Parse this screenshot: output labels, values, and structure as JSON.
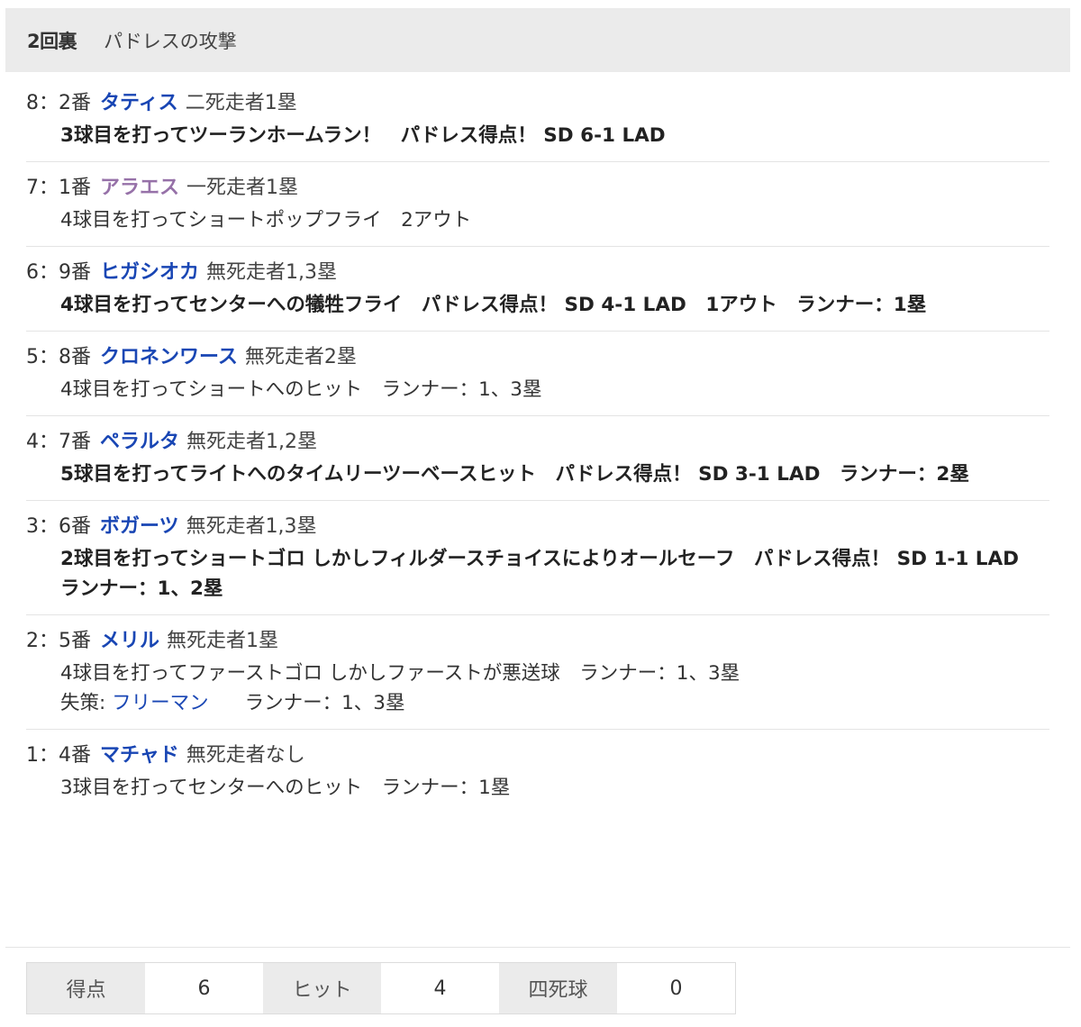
{
  "header": {
    "inning": "2回裏",
    "attack": "パドレスの攻撃"
  },
  "plays": [
    {
      "seq": "8：2番",
      "player": "タティス",
      "situation": "二死走者1塁",
      "result": "3球目を打ってツーランホームラン！　パドレス得点！ SD 6-1 LAD",
      "scored": true
    },
    {
      "seq": "7：1番",
      "player": "アラエス",
      "situation": "一死走者1塁",
      "result": "4球目を打ってショートポップフライ　2アウト",
      "scored": false
    },
    {
      "seq": "6：9番",
      "player": "ヒガシオカ",
      "situation": "無死走者1,3塁",
      "result": "4球目を打ってセンターへの犠牲フライ　パドレス得点！ SD 4-1 LAD　1アウト　ランナー：1塁",
      "scored": true
    },
    {
      "seq": "5：8番",
      "player": "クロネンワース",
      "situation": "無死走者2塁",
      "result": "4球目を打ってショートへのヒット　ランナー：1、3塁",
      "scored": false
    },
    {
      "seq": "4：7番",
      "player": "ペラルタ",
      "situation": "無死走者1,2塁",
      "result": "5球目を打ってライトへのタイムリーツーベースヒット　パドレス得点！ SD 3-1 LAD　ランナー：2塁",
      "scored": true
    },
    {
      "seq": "3：6番",
      "player": "ボガーツ",
      "situation": "無死走者1,3塁",
      "result": "2球目を打ってショートゴロ しかしフィルダースチョイスによりオールセーフ　パドレス得点！ SD 1-1 LAD　ランナー：1、2塁",
      "scored": true
    },
    {
      "seq": "2：5番",
      "player": "メリル",
      "situation": "無死走者1塁",
      "result": "4球目を打ってファーストゴロ しかしファーストが悪送球　ランナー：1、3塁",
      "scored": false,
      "error_label": "失策: ",
      "error_fielder": "フリーマン",
      "error_after": "ランナー：1、3塁"
    },
    {
      "seq": "1：4番",
      "player": "マチャド",
      "situation": "無死走者なし",
      "result": "3球目を打ってセンターへのヒット　ランナー：1塁",
      "scored": false
    }
  ],
  "stats": [
    {
      "label": "得点",
      "value": "6"
    },
    {
      "label": "ヒット",
      "value": "4"
    },
    {
      "label": "四死球",
      "value": "0"
    }
  ],
  "colors": {
    "player_link": "#1946b4",
    "player_visited": "#9671a8",
    "header_bg": "#ebebeb"
  }
}
